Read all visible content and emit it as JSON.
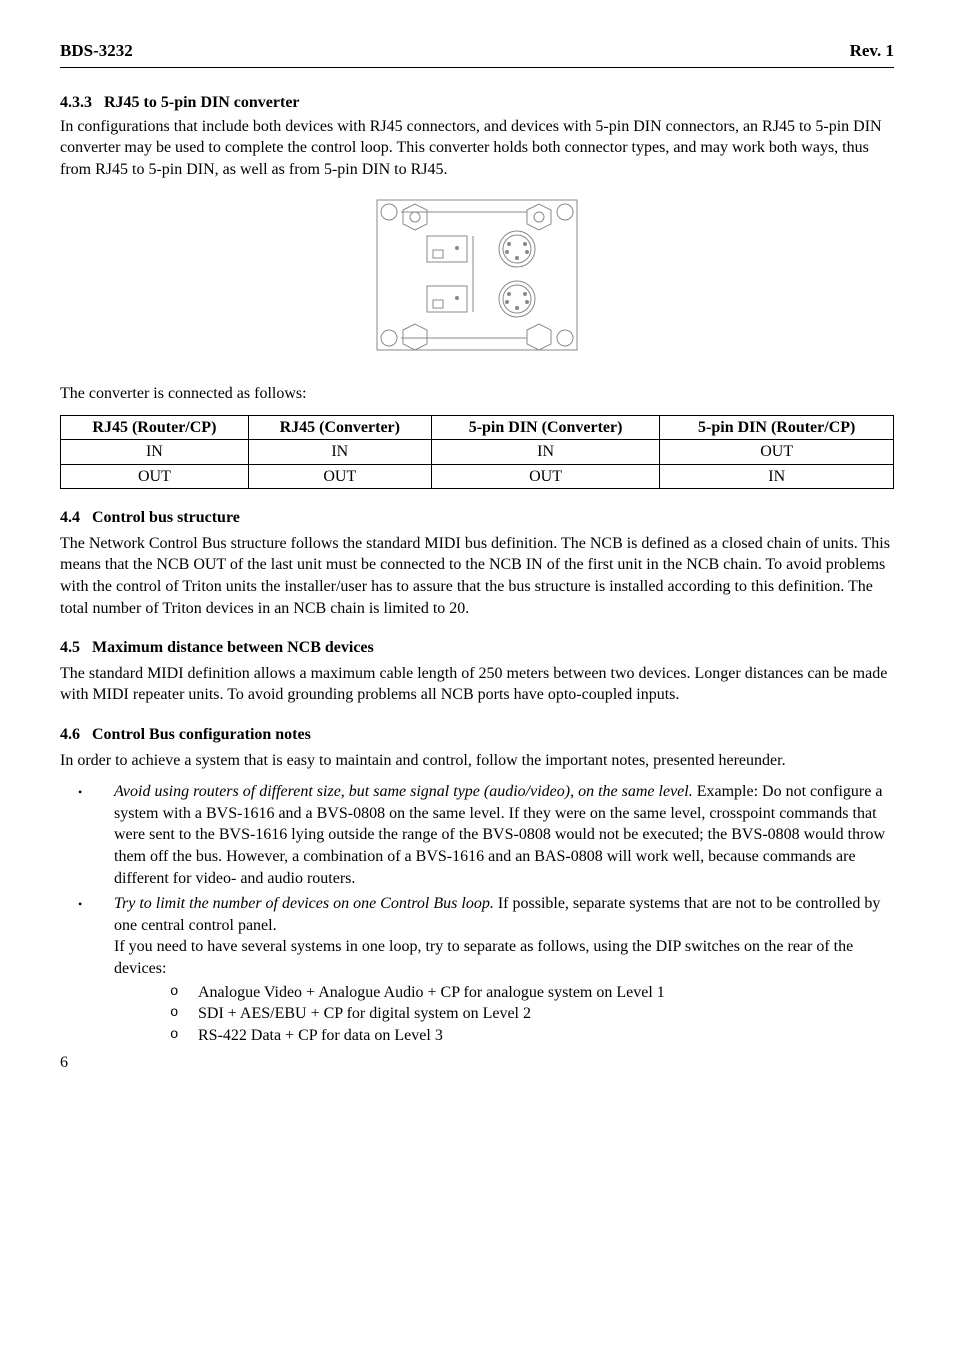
{
  "header": {
    "left": "BDS-3232",
    "right": "Rev. 1"
  },
  "sec433": {
    "num": "4.3.3",
    "title": "RJ45 to 5-pin DIN converter",
    "body": "In configurations that include both devices with RJ45 connectors, and devices with 5-pin DIN connectors, an RJ45 to 5-pin DIN converter may be used to complete the control loop. This converter holds both connector types, and may work both ways, thus from RJ45 to 5-pin DIN, as well as from 5-pin DIN to RJ45."
  },
  "conv_intro": "The converter is connected as follows:",
  "table": {
    "headers": [
      "RJ45 (Router/CP)",
      "RJ45 (Converter)",
      "5-pin DIN (Converter)",
      "5-pin DIN (Router/CP)"
    ],
    "rows": [
      [
        "IN",
        "IN",
        "IN",
        "OUT"
      ],
      [
        "OUT",
        "OUT",
        "OUT",
        "IN"
      ]
    ]
  },
  "sec44": {
    "num": "4.4",
    "title": "Control bus structure",
    "body": "The Network Control Bus structure follows the standard MIDI bus definition. The NCB is defined as a closed chain of units. This means that the NCB OUT of the last unit must be connected to the NCB IN of the first unit in the NCB chain. To avoid problems with the control of Triton units the installer/user has to assure that the bus structure is installed according to this definition. The total number of Triton devices in an NCB chain is limited to 20."
  },
  "sec45": {
    "num": "4.5",
    "title": "Maximum distance between NCB devices",
    "body": "The standard MIDI definition allows a maximum cable length of 250 meters between two devices. Longer distances can be made with MIDI repeater units. To avoid grounding problems all NCB ports have opto-coupled inputs."
  },
  "sec46": {
    "num": "4.6",
    "title": "Control Bus configuration notes",
    "intro": "In order to achieve a system that is easy to maintain and control, follow the important notes, presented hereunder.",
    "b1": {
      "lead_italic": "Avoid using routers of different size, but same signal type (audio/video), on the same level.",
      "rest": " Example: Do not configure a system with a BVS-1616 and a BVS-0808 on the same level. If they were on the same level, crosspoint commands that were sent to the BVS-1616 lying outside the range of the BVS-0808 would not be executed; the BVS-0808 would throw them off the bus. However, a combination of a BVS-1616 and an BAS-0808 will work well, because commands are different for video- and audio routers."
    },
    "b2": {
      "lead_italic": "Try to limit the number of devices on one Control Bus loop.",
      "rest1": " If possible, separate systems that are not to be controlled by one central control panel.",
      "line2": "If you need to have several systems in one loop, try to separate as follows, using the DIP switches on the rear of the devices:",
      "sub": [
        "Analogue Video + Analogue Audio + CP for analogue system on Level 1",
        "SDI + AES/EBU + CP for digital system on Level 2",
        "RS-422 Data + CP for data on Level 3"
      ]
    }
  },
  "pagenum": "6"
}
